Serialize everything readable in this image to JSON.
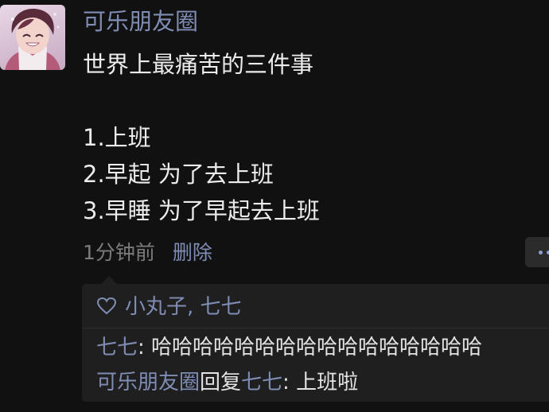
{
  "post": {
    "username": "可乐朋友圈",
    "text": "世界上最痛苦的三件事\n\n1.上班\n2.早起 为了去上班\n3.早睡 为了早起去上班",
    "time": "1分钟前",
    "delete_label": "删除"
  },
  "interactions": {
    "likes": "小丸子, 七七",
    "comments": [
      {
        "author": "七七",
        "separator": ": ",
        "content": "哈哈哈哈哈哈哈哈哈哈哈哈哈哈哈哈"
      },
      {
        "author": "可乐朋友圈",
        "reply_word": "回复",
        "target": "七七",
        "separator": ": ",
        "content": "上班啦"
      }
    ]
  },
  "icons": {
    "avatar": "anime-boy-avatar",
    "like": "heart-icon",
    "more": "more-dots-icon"
  },
  "colors": {
    "background": "#111111",
    "name_link": "#7f8db4",
    "body_text": "#ececec",
    "meta_text": "#7b7b7b",
    "comment_panel": "#1f1f1f"
  }
}
